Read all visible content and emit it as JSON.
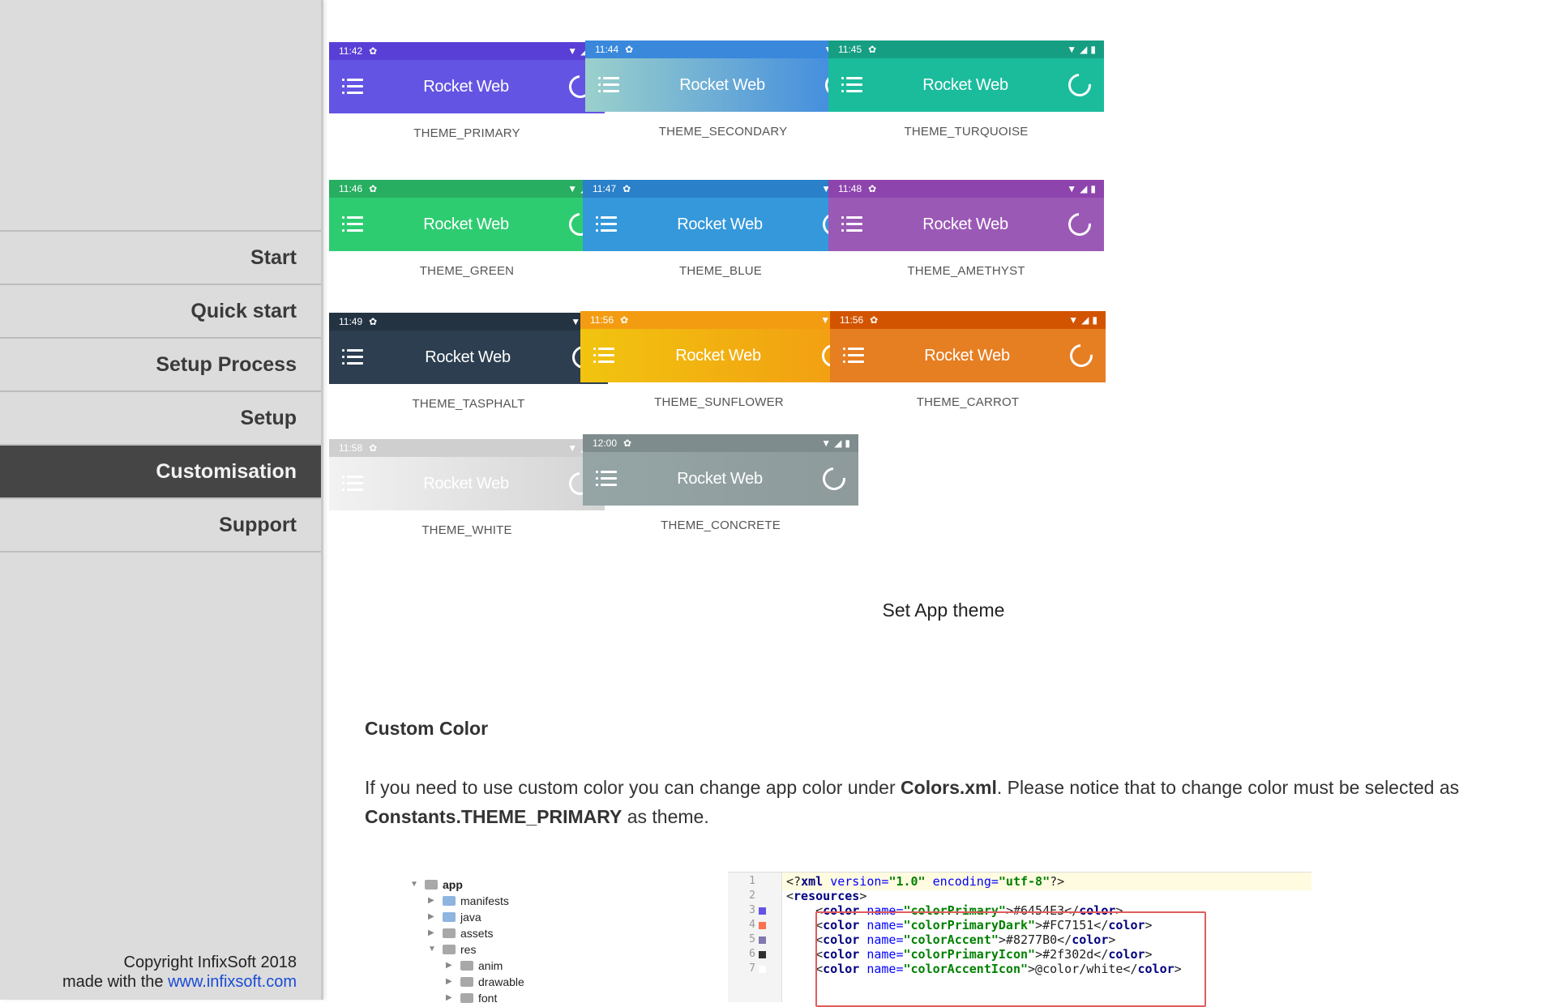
{
  "sidebar": {
    "nav": [
      {
        "label": "Start",
        "active": false
      },
      {
        "label": "Quick start",
        "active": false
      },
      {
        "label": "Setup Process",
        "active": false
      },
      {
        "label": "Setup",
        "active": false
      },
      {
        "label": "Customisation",
        "active": true
      },
      {
        "label": "Support",
        "active": false
      }
    ],
    "copyright": "Copyright InfixSoft 2018",
    "made_with": "made with the",
    "link": "www.infixsoft.com"
  },
  "themes": [
    {
      "time": "11:42",
      "title": "Rocket Web",
      "label": "THEME_PRIMARY",
      "status_color": "#5a3fd6",
      "bar_color": "#6454e3",
      "bar_color2": "#6454e3",
      "fg": "#ffffff"
    },
    {
      "time": "11:44",
      "title": "Rocket Web",
      "label": "THEME_SECONDARY",
      "status_color": "#3a88dc",
      "bar_color": "#9bd0cc",
      "bar_color2": "#3a86e0",
      "fg": "#ffffff"
    },
    {
      "time": "11:45",
      "title": "Rocket Web",
      "label": "THEME_TURQUOISE",
      "status_color": "#169e83",
      "bar_color": "#1abc9c",
      "bar_color2": "#1abc9c",
      "fg": "#ffffff"
    },
    {
      "time": "11:46",
      "title": "Rocket Web",
      "label": "THEME_GREEN",
      "status_color": "#27ae60",
      "bar_color": "#2ecc71",
      "bar_color2": "#2ecc71",
      "fg": "#ffffff"
    },
    {
      "time": "11:47",
      "title": "Rocket Web",
      "label": "THEME_BLUE",
      "status_color": "#2a80c9",
      "bar_color": "#3498db",
      "bar_color2": "#3498db",
      "fg": "#ffffff"
    },
    {
      "time": "11:48",
      "title": "Rocket Web",
      "label": "THEME_AMETHYST",
      "status_color": "#8e44ad",
      "bar_color": "#9b59b6",
      "bar_color2": "#9b59b6",
      "fg": "#ffffff"
    },
    {
      "time": "11:49",
      "title": "Rocket Web",
      "label": "THEME_TASPHALT",
      "status_color": "#243342",
      "bar_color": "#2c3e50",
      "bar_color2": "#2c3e50",
      "fg": "#ffffff"
    },
    {
      "time": "11:56",
      "title": "Rocket Web",
      "label": "THEME_SUNFLOWER",
      "status_color": "#f39c12",
      "bar_color": "#f1c40f",
      "bar_color2": "#f39c12",
      "fg": "#ffffff"
    },
    {
      "time": "11:56",
      "title": "Rocket Web",
      "label": "THEME_CARROT",
      "status_color": "#d35400",
      "bar_color": "#e67e22",
      "bar_color2": "#e67e22",
      "fg": "#ffffff"
    },
    {
      "time": "11:58",
      "title": "Rocket Web",
      "label": "THEME_WHITE",
      "status_color": "#cfcfcf",
      "bar_color": "#f2f2f2",
      "bar_color2": "#d4d4d4",
      "fg": "#ffffff"
    },
    {
      "time": "12:00",
      "title": "Rocket Web",
      "label": "THEME_CONCRETE",
      "status_color": "#7f8c8d",
      "bar_color": "#95a5a6",
      "bar_color2": "#8e9a9b",
      "fg": "#ffffff"
    }
  ],
  "main": {
    "caption": "Set App theme",
    "custom_heading": "Custom Color",
    "para": {
      "p1": "If you need to use custom color you can change app color under ",
      "b1": "Colors.xml",
      "p2": ". Please notice that to change color must be selected as ",
      "b2": "Constants.THEME_PRIMARY",
      "p3": " as theme."
    }
  },
  "tree": [
    {
      "indent": 0,
      "open": true,
      "name": "app",
      "bold": true,
      "grey": true
    },
    {
      "indent": 1,
      "open": false,
      "name": "manifests",
      "bold": false,
      "grey": false
    },
    {
      "indent": 1,
      "open": false,
      "name": "java",
      "bold": false,
      "grey": false
    },
    {
      "indent": 1,
      "open": false,
      "name": "assets",
      "bold": false,
      "grey": true
    },
    {
      "indent": 1,
      "open": true,
      "name": "res",
      "bold": false,
      "grey": true
    },
    {
      "indent": 2,
      "open": false,
      "name": "anim",
      "bold": false,
      "grey": true
    },
    {
      "indent": 2,
      "open": false,
      "name": "drawable",
      "bold": false,
      "grey": true
    },
    {
      "indent": 2,
      "open": false,
      "name": "font",
      "bold": false,
      "grey": true
    }
  ],
  "code_lines": [
    {
      "n": "1",
      "swatch": "",
      "html_parts": [
        [
          "pi",
          "<?"
        ],
        [
          "tag",
          "xml "
        ],
        [
          "attr",
          "version="
        ],
        [
          "str",
          "\"1.0\" "
        ],
        [
          "attr",
          "encoding="
        ],
        [
          "str",
          "\"utf-8\""
        ],
        [
          "pi",
          "?>"
        ]
      ]
    },
    {
      "n": "2",
      "swatch": "",
      "html_parts": [
        [
          "pi",
          "<"
        ],
        [
          "tag",
          "resources"
        ],
        [
          "pi",
          ">"
        ]
      ]
    },
    {
      "n": "3",
      "swatch": "#6454E3",
      "html_parts": [
        [
          "pi",
          "    <"
        ],
        [
          "tag",
          "color "
        ],
        [
          "attr",
          "name="
        ],
        [
          "str",
          "\"colorPrimary\""
        ],
        [
          "pi",
          ">#6454E3</"
        ],
        [
          "tag",
          "color"
        ],
        [
          "pi",
          ">"
        ]
      ]
    },
    {
      "n": "4",
      "swatch": "#FC7151",
      "html_parts": [
        [
          "pi",
          "    <"
        ],
        [
          "tag",
          "color "
        ],
        [
          "attr",
          "name="
        ],
        [
          "str",
          "\"colorPrimaryDark\""
        ],
        [
          "pi",
          ">#FC7151</"
        ],
        [
          "tag",
          "color"
        ],
        [
          "pi",
          ">"
        ]
      ]
    },
    {
      "n": "5",
      "swatch": "#8277B0",
      "html_parts": [
        [
          "pi",
          "    <"
        ],
        [
          "tag",
          "color "
        ],
        [
          "attr",
          "name="
        ],
        [
          "str",
          "\"colorAccent\""
        ],
        [
          "pi",
          ">#8277B0</"
        ],
        [
          "tag",
          "color"
        ],
        [
          "pi",
          ">"
        ]
      ]
    },
    {
      "n": "6",
      "swatch": "#2f302d",
      "html_parts": [
        [
          "pi",
          "    <"
        ],
        [
          "tag",
          "color "
        ],
        [
          "attr",
          "name="
        ],
        [
          "str",
          "\"colorPrimaryIcon\""
        ],
        [
          "pi",
          ">#2f302d</"
        ],
        [
          "tag",
          "color"
        ],
        [
          "pi",
          ">"
        ]
      ]
    },
    {
      "n": "7",
      "swatch": "#ffffff",
      "html_parts": [
        [
          "pi",
          "    <"
        ],
        [
          "tag",
          "color "
        ],
        [
          "attr",
          "name="
        ],
        [
          "str",
          "\"colorAccentIcon\""
        ],
        [
          "pi",
          ">@color/white</"
        ],
        [
          "tag",
          "color"
        ],
        [
          "pi",
          ">"
        ]
      ]
    }
  ]
}
